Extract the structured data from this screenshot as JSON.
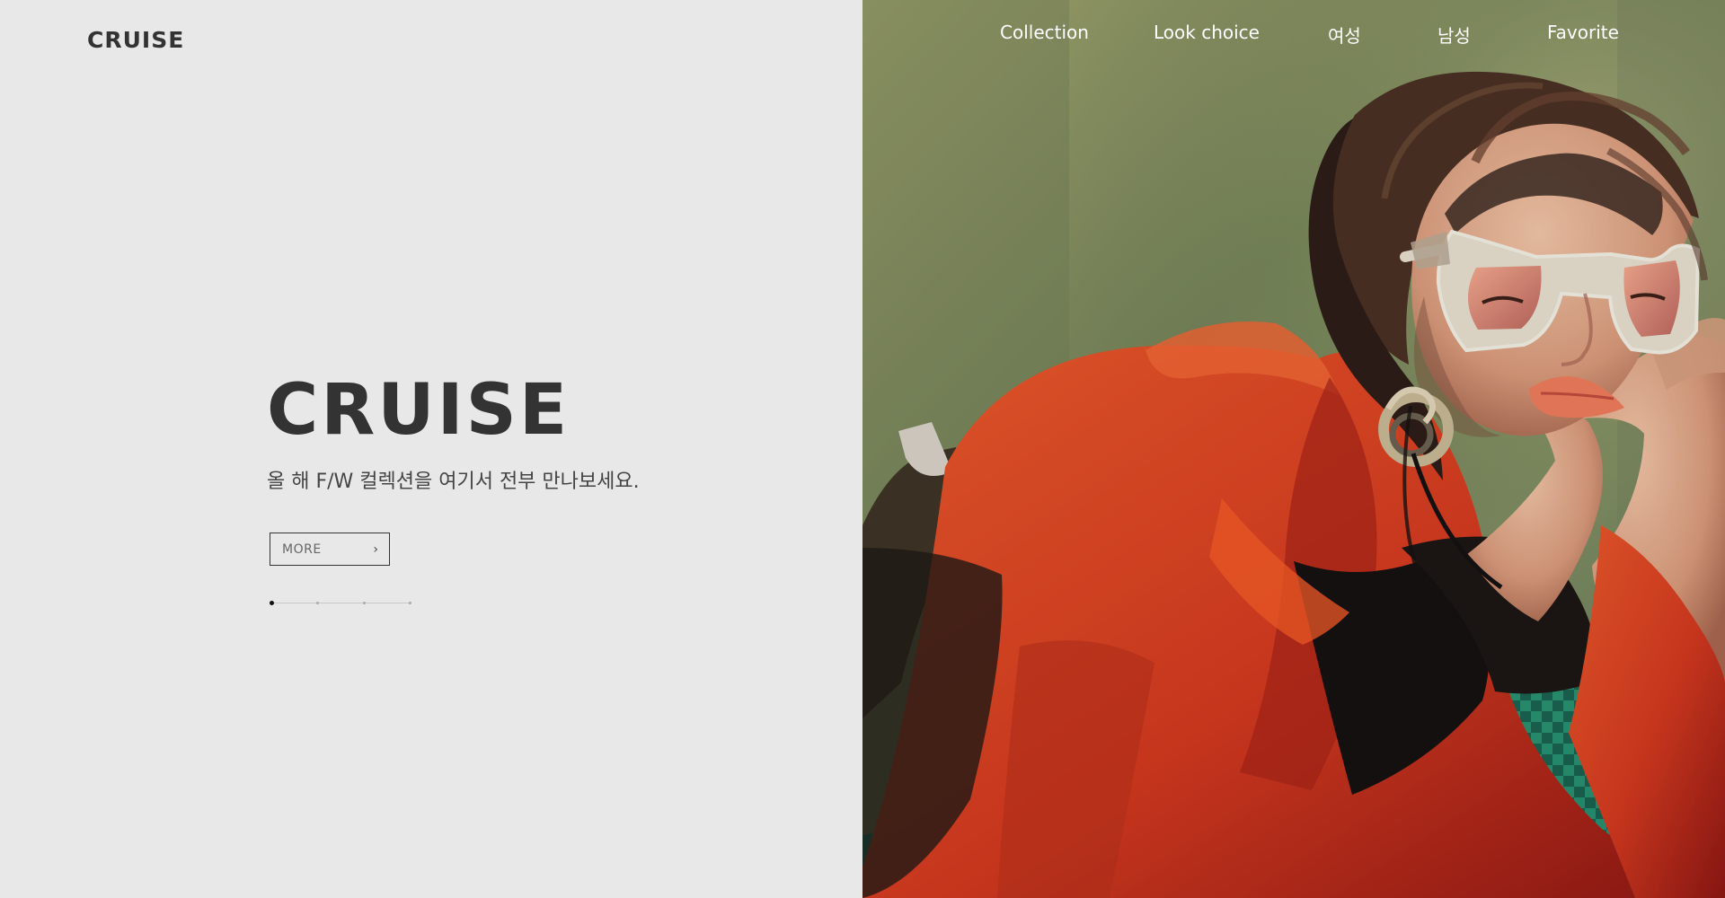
{
  "brand": {
    "logo_text": "CRUISE"
  },
  "nav": {
    "items": [
      {
        "label": "Collection"
      },
      {
        "label": "Look choice"
      },
      {
        "label": "여성"
      },
      {
        "label": "남성"
      },
      {
        "label": "Favorite"
      }
    ]
  },
  "hero": {
    "title": "CRUISE",
    "subtitle": "올 해 F/W 컬렉션을 여기서 전부 만나보세요.",
    "button_label": "MORE",
    "button_icon": "chevron-right-icon"
  },
  "slider": {
    "total": 4,
    "active_index": 1
  },
  "colors": {
    "left_background": "#e8e8e8",
    "text_dark": "#333333",
    "nav_text": "#ffffff",
    "photo_wall": "#8f9a59",
    "jacket": "#d63b1c",
    "skin": "#e7b59b"
  },
  "image": {
    "subject": "fashion-model-photo"
  }
}
